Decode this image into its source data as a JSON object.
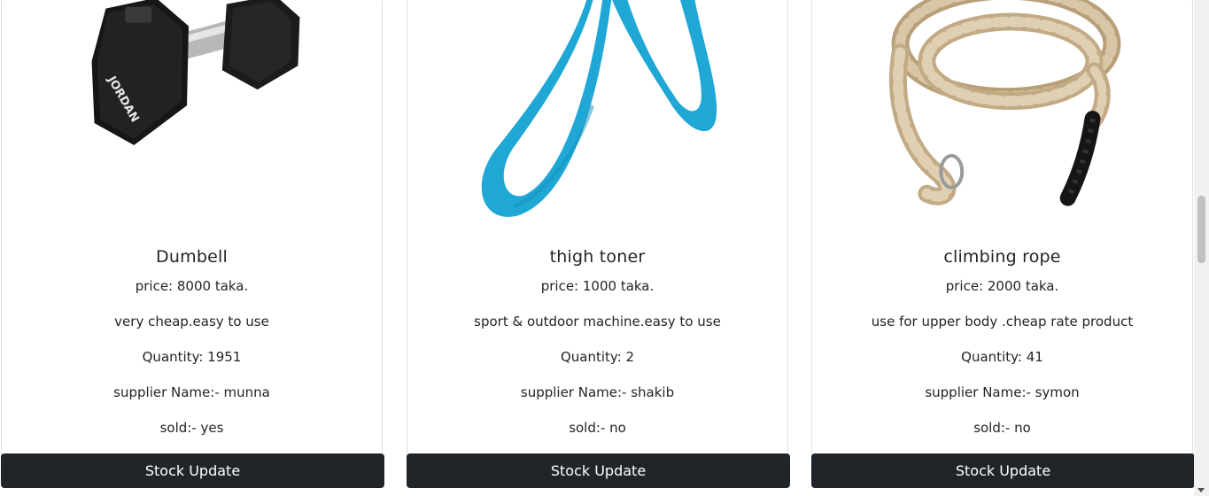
{
  "products": [
    {
      "name": "Dumbell",
      "price": "price: 8000 taka.",
      "description": "very cheap.easy to use",
      "quantity": "Quantity: 1951",
      "supplier": "supplier Name:- munna",
      "sold": "sold:- yes",
      "button_label": "Stock Update",
      "image_icon": "dumbbell-image"
    },
    {
      "name": "thigh toner",
      "price": "price: 1000 taka.",
      "description": "sport & outdoor machine.easy to use",
      "quantity": "Quantity: 2",
      "supplier": "supplier Name:- shakib",
      "sold": "sold:- no",
      "button_label": "Stock Update",
      "image_icon": "thigh-toner-image"
    },
    {
      "name": "climbing rope",
      "price": "price: 2000 taka.",
      "description": "use for upper body .cheap rate product",
      "quantity": "Quantity: 41",
      "supplier": "supplier Name:- symon",
      "sold": "sold:- no",
      "button_label": "Stock Update",
      "image_icon": "climbing-rope-image"
    }
  ],
  "dumbbell_brand": "JORDAN",
  "colors": {
    "button_bg": "#212529",
    "button_text": "#ffffff",
    "toner_blue": "#1fa7d6",
    "rope_tan": "#cdb898"
  }
}
